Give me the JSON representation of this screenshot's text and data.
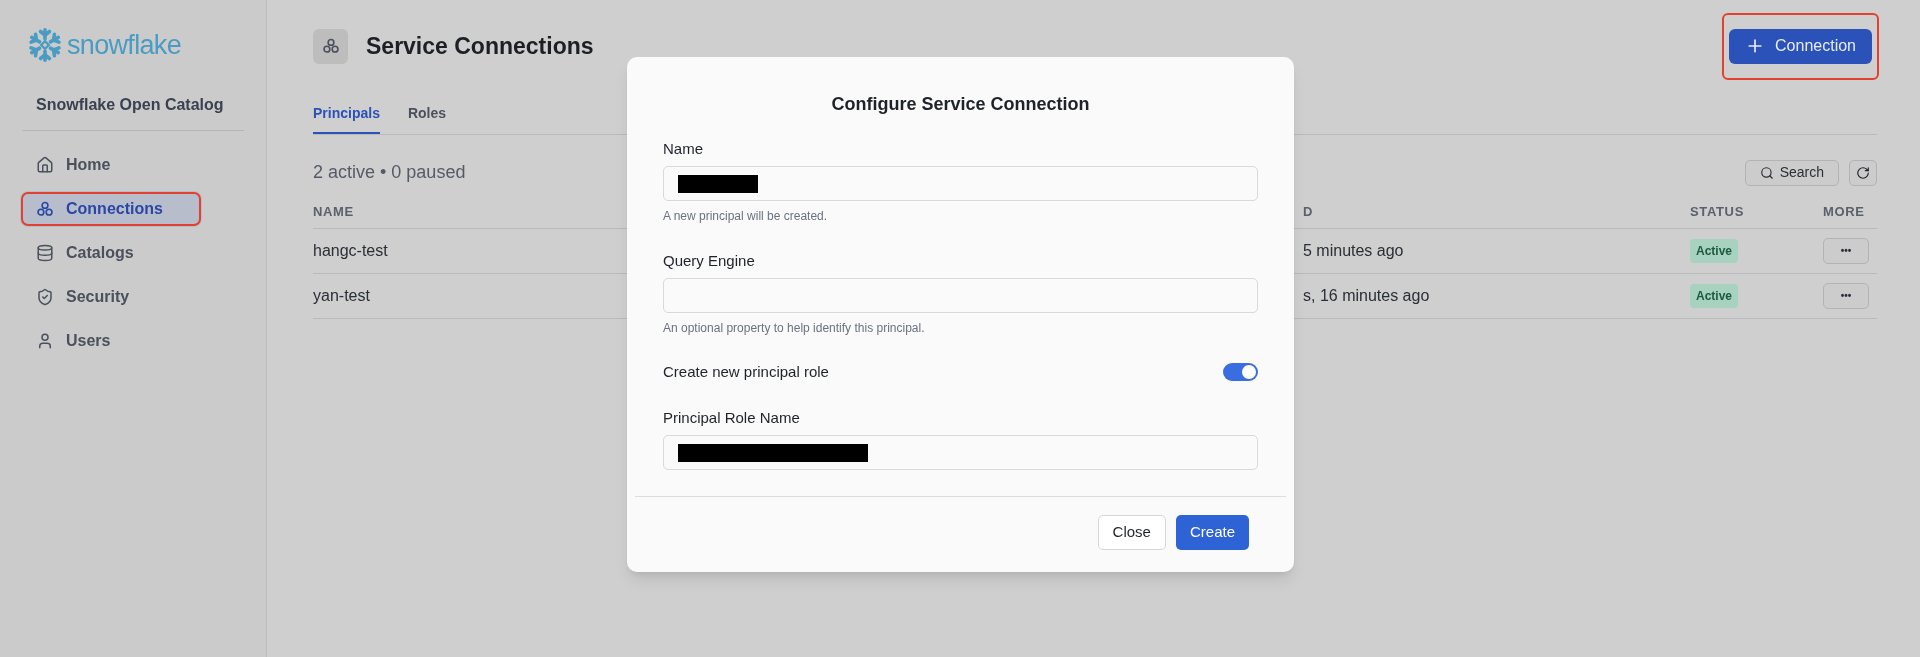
{
  "sidebar": {
    "brand": "snowflake",
    "title": "Snowflake Open Catalog",
    "items": [
      {
        "label": "Home",
        "selected": false,
        "highlighted": false
      },
      {
        "label": "Connections",
        "selected": true,
        "highlighted": true
      },
      {
        "label": "Catalogs",
        "selected": false,
        "highlighted": false
      },
      {
        "label": "Security",
        "selected": false,
        "highlighted": false
      },
      {
        "label": "Users",
        "selected": false,
        "highlighted": false
      }
    ]
  },
  "header": {
    "title": "Service Connections",
    "add_button": {
      "label": "Connection",
      "highlighted": true
    }
  },
  "tabs": [
    {
      "label": "Principals",
      "selected": true
    },
    {
      "label": "Roles",
      "selected": false
    }
  ],
  "summary": "2 active • 0 paused",
  "search_button": "Search",
  "table": {
    "columns": [
      "NAME",
      "D",
      "STATUS",
      "MORE"
    ],
    "rows": [
      {
        "name": "hangc-test",
        "column_2": "5 minutes ago",
        "status": "Active",
        "more": "•••"
      },
      {
        "name": "yan-test",
        "column_2": "s, 16 minutes ago",
        "status": "Active",
        "more": "•••"
      }
    ]
  },
  "modal": {
    "title": "Configure Service Connection",
    "name_field": {
      "label": "Name",
      "redacted": true,
      "hint": "A new principal will be created."
    },
    "query_engine_field": {
      "label": "Query Engine",
      "hint": "An optional property to help identify this principal."
    },
    "create_role": {
      "label": "Create new principal role",
      "on": true
    },
    "role_name_field": {
      "label": "Principal Role Name",
      "redacted": true
    },
    "buttons": [
      {
        "label": "Close",
        "kind": "secondary"
      },
      {
        "label": "Create",
        "kind": "primary"
      }
    ]
  }
}
